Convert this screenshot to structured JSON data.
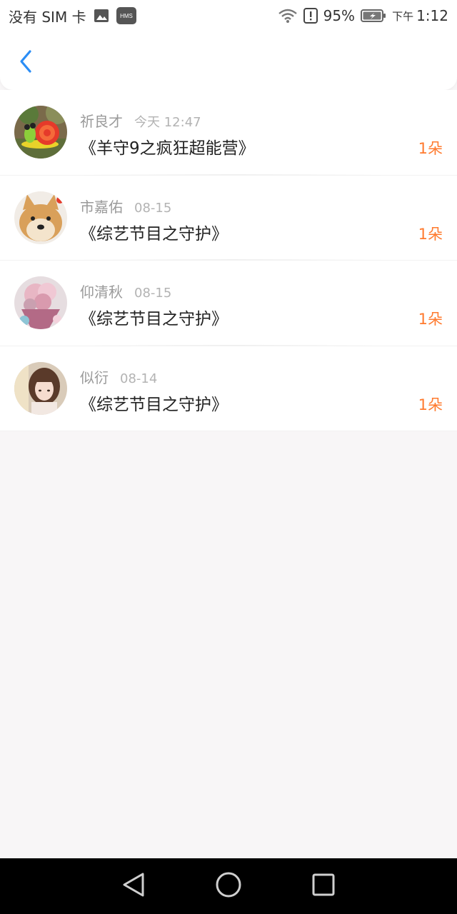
{
  "status_bar": {
    "carrier": "没有 SIM 卡",
    "battery": "95%",
    "ampm": "下午",
    "time": "1:12",
    "hms_label": "HMS"
  },
  "header": {
    "back_icon": "chevron-left-icon"
  },
  "items": [
    {
      "user": "祈良才",
      "time": "今天 12:47",
      "title": "《羊守9之疯狂超能营》",
      "count": "1朵",
      "avatar": "snail-toy-avatar"
    },
    {
      "user": "市嘉佑",
      "time": "08-15",
      "title": "《综艺节目之守护》",
      "count": "1朵",
      "avatar": "shiba-dog-avatar"
    },
    {
      "user": "仰清秋",
      "time": "08-15",
      "title": "《综艺节目之守护》",
      "count": "1朵",
      "avatar": "flower-bouquet-avatar"
    },
    {
      "user": "似衍",
      "time": "08-14",
      "title": "《综艺节目之守护》",
      "count": "1朵",
      "avatar": "girl-portrait-avatar"
    }
  ],
  "colors": {
    "accent_orange": "#ff7a2e",
    "back_blue": "#2b8df5",
    "page_bg": "#f8f6f7"
  }
}
